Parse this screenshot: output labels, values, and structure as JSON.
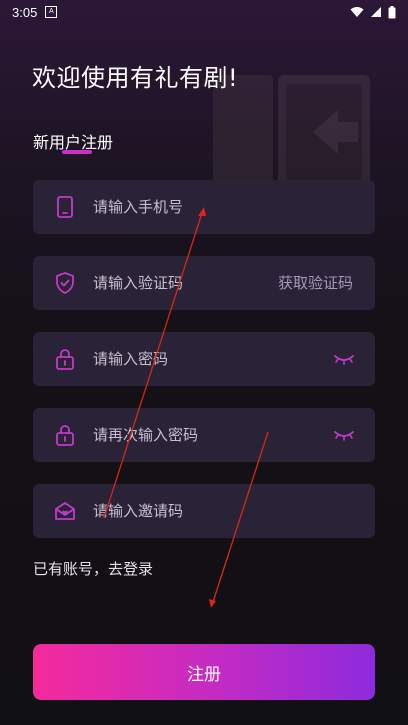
{
  "status_bar": {
    "time": "3:05",
    "notification_letter": "A"
  },
  "page": {
    "welcome_title": "欢迎使用有礼有剧!",
    "subtitle": "新用户注册"
  },
  "form": {
    "phone_placeholder": "请输入手机号",
    "code_placeholder": "请输入验证码",
    "get_code_label": "获取验证码",
    "password_placeholder": "请输入密码",
    "confirm_password_placeholder": "请再次输入密码",
    "invite_code_placeholder": "请输入邀请码"
  },
  "login_link": "已有账号，去登录",
  "register_button": "注册",
  "colors": {
    "accent": "#c92ecb",
    "icon": "#c33ac9",
    "field_bg": "#2a2236",
    "button_gradient_start": "#f52a9c",
    "button_gradient_end": "#8d2bdd",
    "annotation_arrow": "#d9261c"
  },
  "icons": {
    "phone": "phone-icon",
    "verify": "shield-check-icon",
    "password": "lock-icon",
    "confirm_password": "lock-icon",
    "invite": "envelope-heart-icon",
    "eye": "eye-closed-icon"
  }
}
